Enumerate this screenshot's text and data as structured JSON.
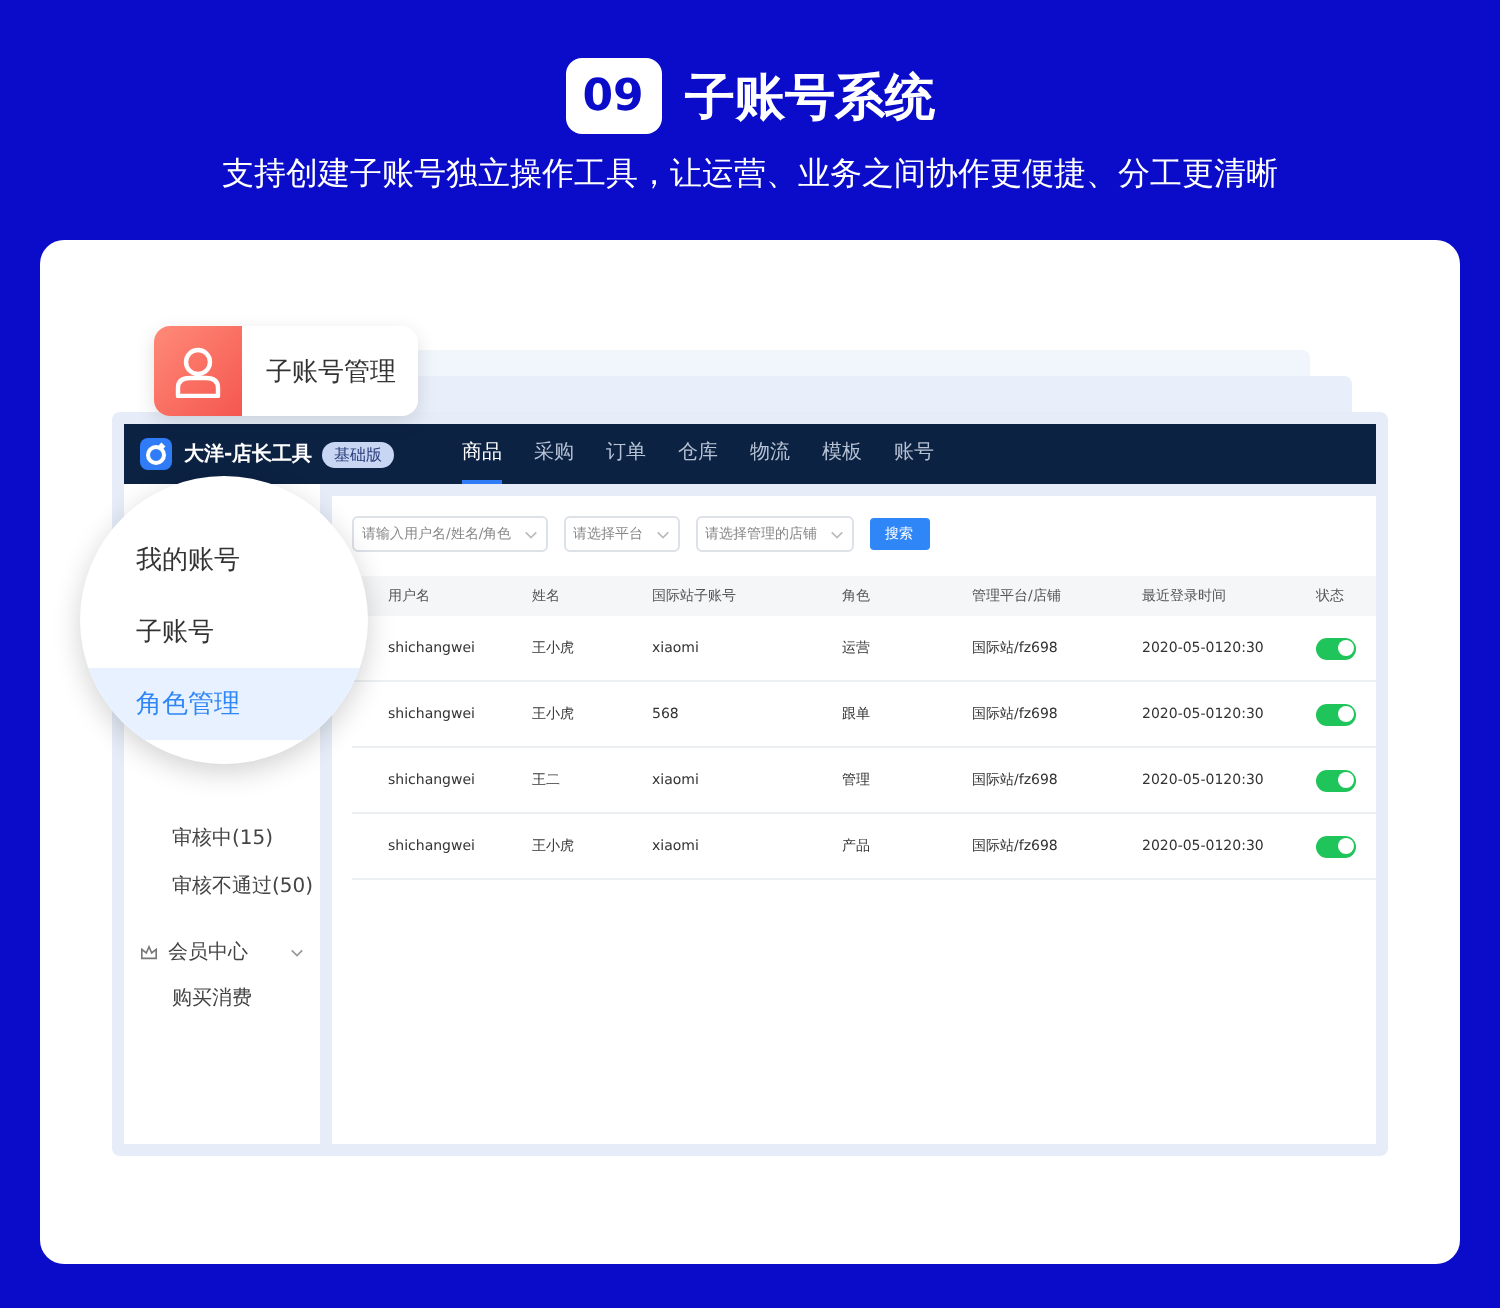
{
  "header": {
    "badge": "09",
    "title": "子账号系统",
    "subtitle": "支持创建子账号独立操作工具，让运营、业务之间协作更便捷、分工更清晰"
  },
  "tag": {
    "label": "子账号管理"
  },
  "app": {
    "brand": "大洋-店长工具",
    "edition": "基础版",
    "nav": [
      {
        "label": "商品",
        "selected": true
      },
      {
        "label": "采购",
        "selected": false
      },
      {
        "label": "订单",
        "selected": false
      },
      {
        "label": "仓库",
        "selected": false
      },
      {
        "label": "物流",
        "selected": false
      },
      {
        "label": "模板",
        "selected": false
      },
      {
        "label": "账号",
        "selected": false
      }
    ],
    "sidebar": [
      {
        "kind": "item",
        "label": "审核中(15)"
      },
      {
        "kind": "item",
        "label": "审核不通过(50)"
      },
      {
        "kind": "group",
        "label": "会员中心",
        "expanded": true
      },
      {
        "kind": "item",
        "label": "购买消费"
      }
    ],
    "filters": [
      {
        "placeholder": "请输入用户名/姓名/角色"
      },
      {
        "placeholder": "请选择平台"
      },
      {
        "placeholder": "请选择管理的店铺"
      }
    ],
    "search_button": "搜索",
    "table": {
      "columns": [
        "用户名",
        "姓名",
        "国际站子账号",
        "角色",
        "管理平台/店铺",
        "最近登录时间",
        "状态"
      ],
      "rows": [
        {
          "cells": [
            "shichangwei",
            "王小虎",
            "xiaomi",
            "运营",
            "国际站/fz698",
            "2020-05-0120:30"
          ],
          "enabled": true
        },
        {
          "cells": [
            "shichangwei",
            "王小虎",
            "568",
            "跟单",
            "国际站/fz698",
            "2020-05-0120:30"
          ],
          "enabled": true
        },
        {
          "cells": [
            "shichangwei",
            "王二",
            "xiaomi",
            "管理",
            "国际站/fz698",
            "2020-05-0120:30"
          ],
          "enabled": true
        },
        {
          "cells": [
            "shichangwei",
            "王小虎",
            "xiaomi",
            "产品",
            "国际站/fz698",
            "2020-05-0120:30"
          ],
          "enabled": true
        }
      ]
    }
  },
  "magnifier": {
    "items": [
      {
        "label": "我的账号",
        "selected": false
      },
      {
        "label": "子账号",
        "selected": false
      },
      {
        "label": "角色管理",
        "selected": true
      }
    ]
  }
}
